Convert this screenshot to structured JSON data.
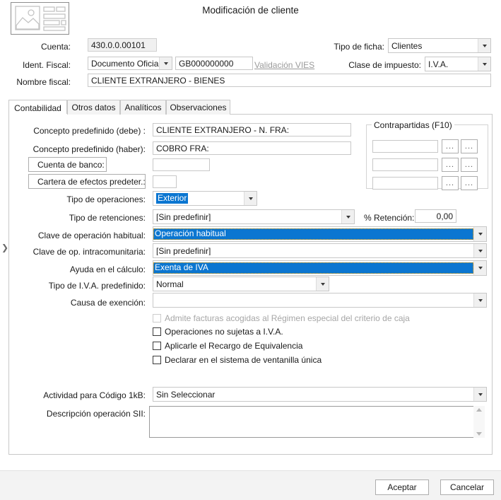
{
  "window": {
    "title": "Modificación de cliente",
    "icon": "image-form-placeholder-icon"
  },
  "header": {
    "cuenta_label": "Cuenta:",
    "cuenta_value": "430.0.0.00101",
    "ident_fiscal_label": "Ident. Fiscal:",
    "ident_fiscal_tipo": "Documento Oficial",
    "ident_fiscal_numero": "GB000000000",
    "validacion_vies_link": "Validación VIES",
    "nombre_fiscal_label": "Nombre fiscal:",
    "nombre_fiscal_value": "CLIENTE EXTRANJERO - BIENES",
    "tipo_ficha_label": "Tipo de ficha:",
    "tipo_ficha_value": "Clientes",
    "clase_impuesto_label": "Clase de impuesto:",
    "clase_impuesto_value": "I.V.A."
  },
  "tabs": [
    {
      "label": "Contabilidad",
      "active": true
    },
    {
      "label": "Otros datos",
      "active": false
    },
    {
      "label": "Analíticos",
      "active": false
    },
    {
      "label": "Observaciones",
      "active": false
    }
  ],
  "form": {
    "concepto_debe_label": "Concepto predefinido (debe) :",
    "concepto_debe_value": "CLIENTE EXTRANJERO - N. FRA:",
    "concepto_haber_label": "Concepto predefinido (haber):",
    "concepto_haber_value": "COBRO FRA:",
    "cuenta_banco_button": "Cuenta de banco:",
    "cuenta_banco_value": "",
    "cartera_efectos_button": "Cartera de efectos predeter.:",
    "cartera_efectos_value": "",
    "tipo_operaciones_label": "Tipo de operaciones:",
    "tipo_operaciones_value": "Exterior",
    "tipo_retenciones_label": "Tipo de retenciones:",
    "tipo_retenciones_value": "[Sin predefinir]",
    "pct_retencion_label": "% Retención:",
    "pct_retencion_value": "0,00",
    "clave_operacion_label": "Clave de operación habitual:",
    "clave_operacion_value": "Operación habitual",
    "clave_intracom_label": "Clave de op. intracomunitaria:",
    "clave_intracom_value": "[Sin predefinir]",
    "ayuda_calculo_label": "Ayuda en el cálculo:",
    "ayuda_calculo_value": "Exenta de IVA",
    "tipo_iva_label": "Tipo de I.V.A. predefinido:",
    "tipo_iva_value": "Normal",
    "causa_exencion_label": "Causa de exención:",
    "causa_exencion_value": "",
    "actividad_label": "Actividad para Código 1kB:",
    "actividad_value": "Sin Seleccionar",
    "descripcion_sii_label": "Descripción operación SII:",
    "descripcion_sii_value": ""
  },
  "checkboxes": [
    {
      "label": "Admite facturas acogidas al Régimen especial del criterio de caja",
      "checked": false,
      "disabled": true
    },
    {
      "label": "Operaciones no sujetas a I.V.A.",
      "checked": false,
      "disabled": false
    },
    {
      "label": "Aplicarle el Recargo de Equivalencia",
      "checked": false,
      "disabled": false
    },
    {
      "label": "Declarar en el sistema de ventanilla única",
      "checked": false,
      "disabled": false
    }
  ],
  "contrapartidas": {
    "caption": "Contrapartidas (F10)",
    "rows": [
      {
        "value": "",
        "btn1": "...",
        "btn2": "..."
      },
      {
        "value": "",
        "btn1": "...",
        "btn2": "..."
      },
      {
        "value": "",
        "btn1": "...",
        "btn2": "..."
      }
    ]
  },
  "footer": {
    "accept_label": "Aceptar",
    "cancel_label": "Cancelar"
  },
  "misc": {
    "expander_glyph": "❯"
  },
  "colors": {
    "selection_blue": "#0b76d1",
    "focus_orange": "#f0a000",
    "panel_border": "#c8c8c8",
    "footer_bg": "#f3f3f3"
  }
}
